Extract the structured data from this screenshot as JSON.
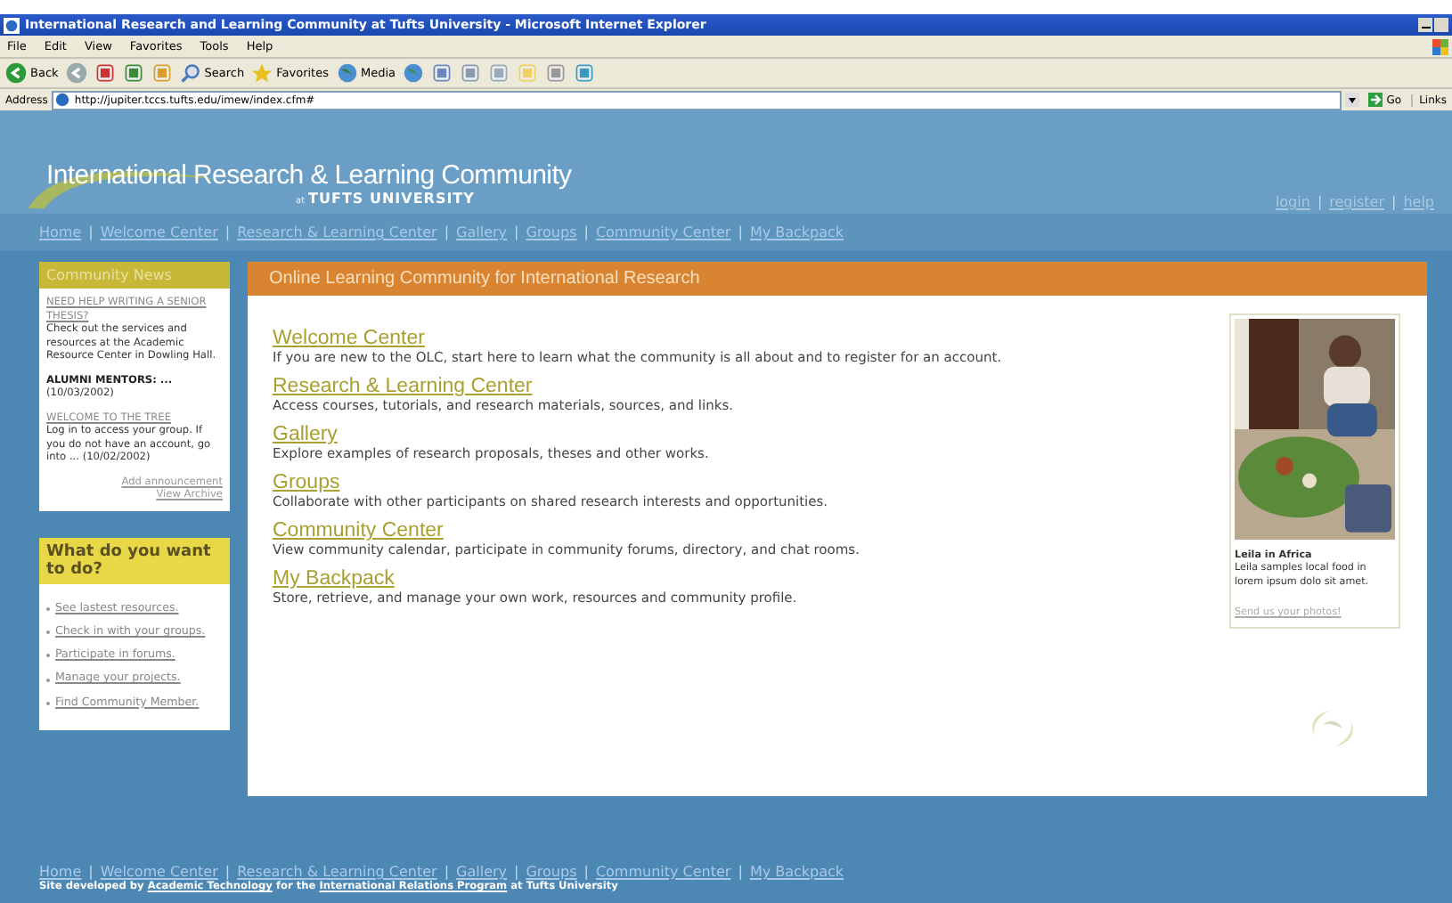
{
  "window": {
    "title": "International Research and Learning Community at Tufts University - Microsoft Internet Explorer"
  },
  "menu": [
    "File",
    "Edit",
    "View",
    "Favorites",
    "Tools",
    "Help"
  ],
  "toolbar": [
    {
      "kind": "back",
      "label": "Back"
    },
    {
      "kind": "forward"
    },
    {
      "kind": "stop"
    },
    {
      "kind": "refresh"
    },
    {
      "kind": "home"
    },
    {
      "kind": "search",
      "label": "Search"
    },
    {
      "kind": "favorites",
      "label": "Favorites"
    },
    {
      "kind": "media",
      "label": "Media"
    },
    {
      "kind": "history"
    },
    {
      "kind": "mail"
    },
    {
      "kind": "print"
    },
    {
      "kind": "edit"
    },
    {
      "kind": "folder"
    },
    {
      "kind": "messenger"
    },
    {
      "kind": "people"
    }
  ],
  "address": {
    "label": "Address",
    "value": "http://jupiter.tccs.tufts.edu/imew/index.cfm#",
    "go": "Go",
    "links": "Links"
  },
  "site": {
    "title": "International Research & Learning Community",
    "subtitle_prefix": "at",
    "subtitle": "TUFTS UNIVERSITY",
    "account_links": [
      "login",
      "register",
      "help"
    ],
    "separator": "|",
    "nav": [
      "Home",
      "Welcome Center",
      "Research & Learning Center",
      "Gallery",
      "Groups",
      "Community Center",
      "My Backpack"
    ]
  },
  "news": {
    "title": "Community News",
    "items": [
      {
        "kind": "link",
        "heading": "NEED HELP WRITING A SENIOR THESIS?",
        "text": "Check out the services and resources at the Academic Resource Center in Dowling Hall."
      },
      {
        "kind": "bold",
        "heading": "ALUMNI MENTORS: ...",
        "text": "(10/03/2002)"
      },
      {
        "kind": "link",
        "heading": "WELCOME TO THE TREE",
        "text": "Log in to access your group. If you do not have an account, go into ... (10/02/2002)"
      }
    ],
    "links": [
      "Add announcement",
      "View Archive"
    ]
  },
  "todo": {
    "title": "What do you want to do?",
    "items": [
      "See lastest resources.",
      "Check in with your groups.",
      "Participate in forums.",
      "Manage your projects.",
      "Find Community Member."
    ]
  },
  "main": {
    "title": "Online Learning Community for International Research",
    "sections": [
      {
        "title": "Welcome Center",
        "text": "If you are new to the OLC, start here to learn what the community is all about and to register for an account."
      },
      {
        "title": "Research & Learning Center",
        "text": "Access courses, tutorials, and research materials, sources, and links."
      },
      {
        "title": "Gallery",
        "text": "Explore examples of research proposals, theses and other works."
      },
      {
        "title": "Groups",
        "text": "Collaborate with other participants on shared research interests and opportunities."
      },
      {
        "title": "Community Center",
        "text": "View community calendar, participate in community forums, directory, and chat rooms."
      },
      {
        "title": "My Backpack",
        "text": "Store, retrieve, and manage your own work, resources and community profile."
      }
    ],
    "photo": {
      "kind": "picture",
      "caption_title": "Leila in Africa",
      "caption": "Leila samples local food in lorem ipsum dolo sit amet.",
      "link": "Send us your photos!"
    }
  },
  "footer": {
    "nav": [
      "Home",
      "Welcome Center",
      "Research & Learning Center",
      "Gallery",
      "Groups",
      "Community Center",
      "My Backpack"
    ],
    "credit": [
      {
        "kind": "text",
        "text": "Site developed by"
      },
      {
        "kind": "link",
        "text": "Academic Technology"
      },
      {
        "kind": "text",
        "text": "for the"
      },
      {
        "kind": "link",
        "text": "International Relations Program"
      },
      {
        "kind": "text",
        "text": "at Tufts University"
      }
    ]
  }
}
